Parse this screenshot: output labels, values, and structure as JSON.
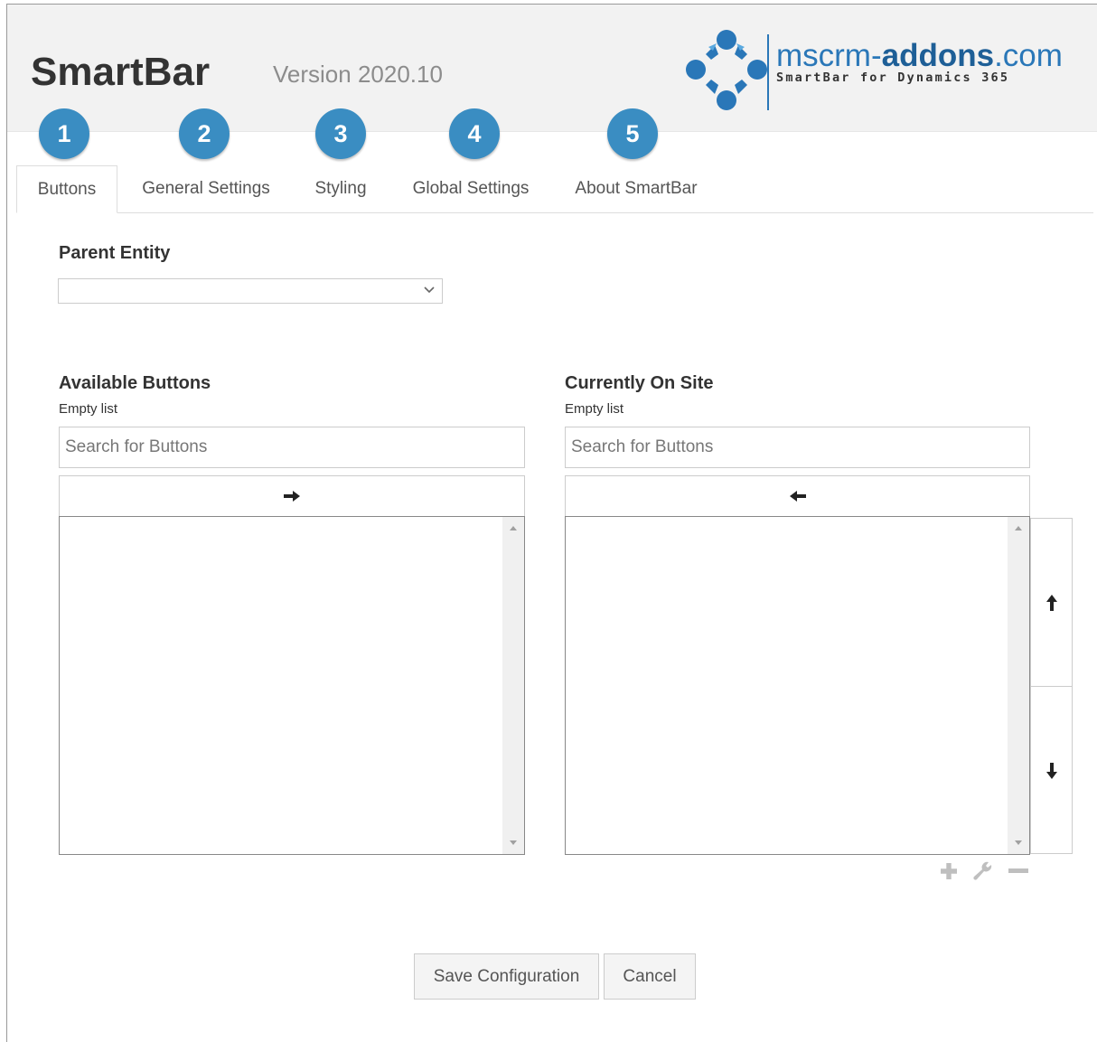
{
  "header": {
    "title": "SmartBar",
    "version": "Version 2020.10",
    "logo": {
      "main_prefix": "mscrm-",
      "main_bold": "addons",
      "main_suffix": ".com",
      "subtitle": "SmartBar for Dynamics 365"
    }
  },
  "steps": [
    "1",
    "2",
    "3",
    "4",
    "5"
  ],
  "tabs": [
    {
      "label": "Buttons",
      "active": true
    },
    {
      "label": "General Settings",
      "active": false
    },
    {
      "label": "Styling",
      "active": false
    },
    {
      "label": "Global Settings",
      "active": false
    },
    {
      "label": "About SmartBar",
      "active": false
    }
  ],
  "parent_entity": {
    "label": "Parent Entity",
    "value": ""
  },
  "available": {
    "title": "Available Buttons",
    "status": "Empty list",
    "search_placeholder": "Search for Buttons",
    "items": []
  },
  "current": {
    "title": "Currently On Site",
    "status": "Empty list",
    "search_placeholder": "Search for Buttons",
    "items": []
  },
  "icons": {
    "move_right": "arrow-right-icon",
    "move_left": "arrow-left-icon",
    "move_up": "arrow-up-icon",
    "move_down": "arrow-down-icon",
    "add": "plus-icon",
    "edit": "wrench-icon",
    "remove": "minus-icon"
  },
  "colors": {
    "accent": "#3a8dc2",
    "brand": "#2a77b8",
    "header_bg": "#f2f2f2"
  },
  "actions": {
    "save_label": "Save Configuration",
    "cancel_label": "Cancel"
  }
}
